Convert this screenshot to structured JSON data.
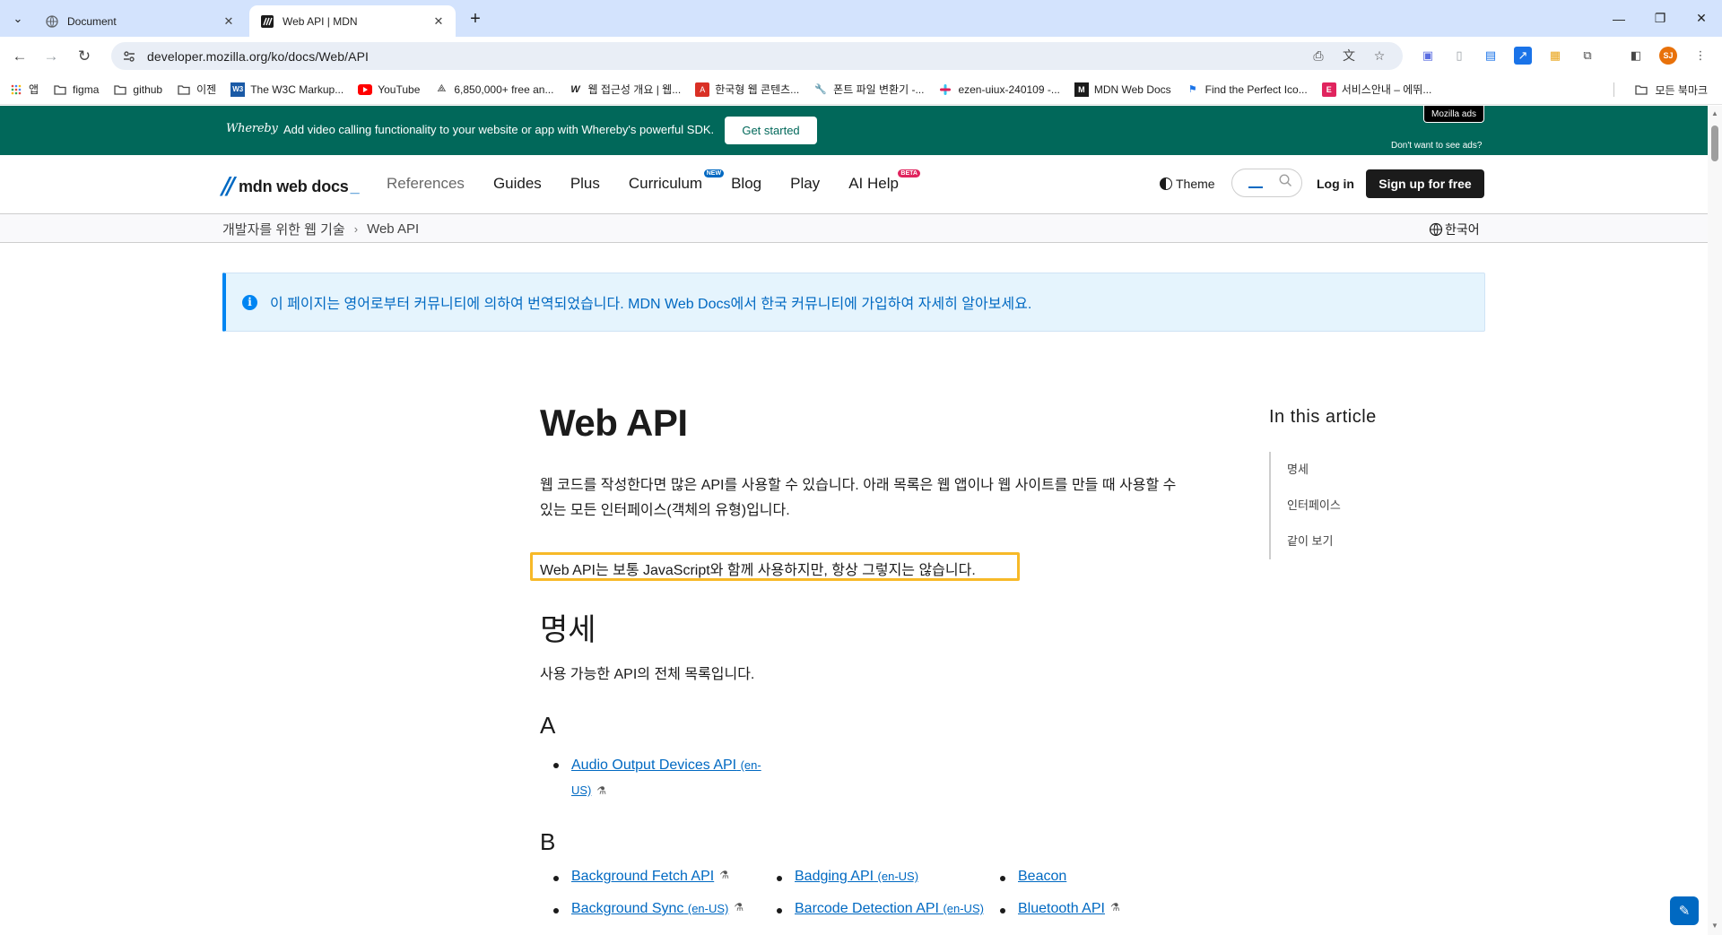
{
  "browser": {
    "tabs": [
      {
        "title": "Document",
        "active": false
      },
      {
        "title": "Web API | MDN",
        "active": true
      }
    ],
    "url": "developer.mozilla.org/ko/docs/Web/API",
    "bookmarks": [
      {
        "label": "앱",
        "icon": "apps-grid-icon"
      },
      {
        "label": "figma",
        "icon": "folder-icon"
      },
      {
        "label": "github",
        "icon": "folder-icon"
      },
      {
        "label": "이젠",
        "icon": "folder-icon"
      },
      {
        "label": "The W3C Markup...",
        "icon": "w3c-icon"
      },
      {
        "label": "YouTube",
        "icon": "youtube-icon"
      },
      {
        "label": "6,850,000+ free an...",
        "icon": "icons-site-icon"
      },
      {
        "label": "웹 접근성 개요 | 웹...",
        "icon": "w-icon"
      },
      {
        "label": "한국형 웹 콘텐츠...",
        "icon": "pdf-icon"
      },
      {
        "label": "폰트 파일 변환기 -...",
        "icon": "wrench-icon"
      },
      {
        "label": "ezen-uiux-240109 -...",
        "icon": "slack-icon"
      },
      {
        "label": "MDN Web Docs",
        "icon": "mdn-icon"
      },
      {
        "label": "Find the Perfect Ico...",
        "icon": "flag-icon"
      },
      {
        "label": "서비스안내 – 에뛰...",
        "icon": "e-icon"
      }
    ],
    "all_bookmarks": "모든 북마크",
    "profile_initials": "SJ"
  },
  "ad": {
    "brand": "Whereby",
    "message": "Add video calling functionality to your website or app with Whereby's powerful SDK.",
    "cta": "Get started",
    "tag": "Mozilla ads",
    "dismiss": "Don't want to see ads?"
  },
  "header": {
    "logo_text": "mdn web docs",
    "nav": [
      {
        "label": "References",
        "badge": ""
      },
      {
        "label": "Guides",
        "badge": ""
      },
      {
        "label": "Plus",
        "badge": ""
      },
      {
        "label": "Curriculum",
        "badge": "NEW"
      },
      {
        "label": "Blog",
        "badge": ""
      },
      {
        "label": "Play",
        "badge": ""
      },
      {
        "label": "AI Help",
        "badge": "BETA"
      }
    ],
    "theme": "Theme",
    "login": "Log in",
    "signup": "Sign up for free"
  },
  "breadcrumbs": {
    "items": [
      "개발자를 위한 웹 기술",
      "Web API"
    ],
    "language": "한국어"
  },
  "notice": "이 페이지는 영어로부터 커뮤니티에 의하여 번역되었습니다. MDN Web Docs에서 한국 커뮤니티에 가입하여 자세히 알아보세요.",
  "article": {
    "title": "Web API",
    "intro_line1": "웹 코드를 작성한다면 많은 API를 사용할 수 있습니다. 아래 목록은 웹 앱이나 웹 사이트를 만들 때 사용할 수",
    "intro_line2": "있는 모든 인터페이스(객체의 유형)입니다.",
    "highlight": "Web API는 보통 JavaScript와 함께 사용하지만, 항상 그렇지는 않습니다.",
    "section_title": "명세",
    "section_sub": "사용 가능한 API의 전체 목록입니다.",
    "letter_a": "A",
    "letter_b": "B",
    "a_item_1": "Audio Output Devices API",
    "a_item_1_locale": "(en-",
    "a_item_1_locale2": "US)",
    "b_col1": [
      {
        "label": "Background Fetch API",
        "locale": ""
      },
      {
        "label": "Background Sync",
        "locale": "(en-US)"
      }
    ],
    "b_col2": [
      {
        "label": "Badging API",
        "locale": "(en-US)"
      },
      {
        "label": "Barcode Detection API",
        "locale": "(en-US)"
      }
    ],
    "b_col3": [
      {
        "label": "Beacon",
        "locale": ""
      },
      {
        "label": "Bluetooth API",
        "locale": ""
      }
    ]
  },
  "toc": {
    "heading": "In this article",
    "items": [
      "명세",
      "인터페이스",
      "같이 보기"
    ]
  },
  "colors": {
    "ad_bg": "#01685a",
    "link": "#0069c2",
    "highlight_border": "#f7b928",
    "notice_bg": "#e5f4fd"
  }
}
